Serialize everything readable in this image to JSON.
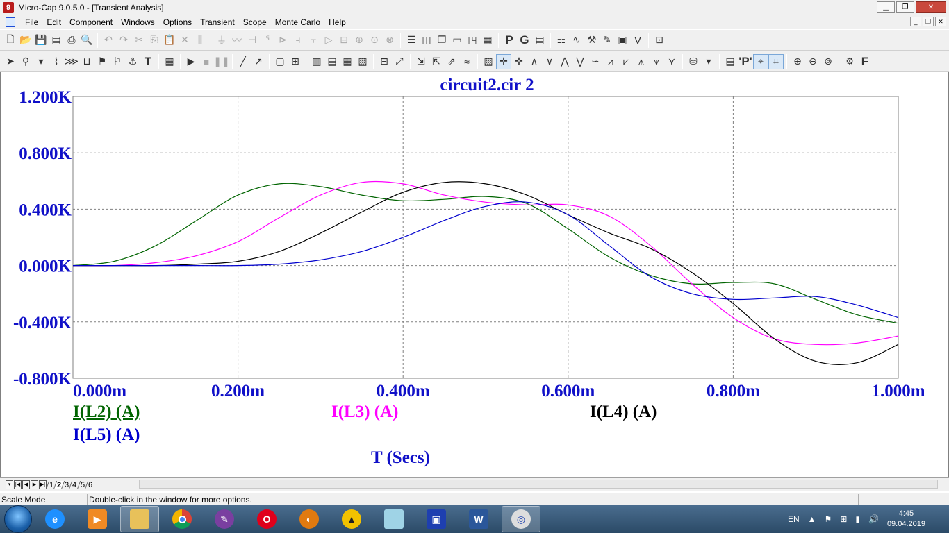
{
  "window": {
    "title": "Micro-Cap 9.0.5.0 - [Transient Analysis]",
    "buttons": {
      "minimize": "▁",
      "maximize": "❐",
      "close": "✕"
    }
  },
  "menu": {
    "items": [
      "File",
      "Edit",
      "Component",
      "Windows",
      "Options",
      "Transient",
      "Scope",
      "Monte Carlo",
      "Help"
    ]
  },
  "toolbar1": {
    "probe_p": "P",
    "probe_g": "G"
  },
  "toolbar2": {
    "text_tool": "T",
    "p_tool": "'P'",
    "f_tool": "F"
  },
  "chart_data": {
    "type": "line",
    "title": "circuit2.cir 2",
    "xlabel": "T (Secs)",
    "ylabel": "",
    "xlim": [
      0,
      1.0
    ],
    "ylim": [
      -0.8,
      1.2
    ],
    "x_ticks": [
      "0.000m",
      "0.200m",
      "0.400m",
      "0.600m",
      "0.800m",
      "1.000m"
    ],
    "y_ticks": [
      "1.200K",
      "0.800K",
      "0.400K",
      "0.000K",
      "-0.400K",
      "-0.800K"
    ],
    "grid": true,
    "x_unit_note": "time in ms (0 to 1.000m)",
    "series": [
      {
        "name": "I(L2) (A)",
        "color": "#006400",
        "x": [
          0,
          0.05,
          0.1,
          0.15,
          0.2,
          0.25,
          0.3,
          0.35,
          0.4,
          0.45,
          0.5,
          0.55,
          0.6,
          0.65,
          0.7,
          0.75,
          0.8,
          0.85,
          0.9,
          0.95,
          1.0
        ],
        "y": [
          0.0,
          0.03,
          0.14,
          0.32,
          0.5,
          0.58,
          0.56,
          0.5,
          0.46,
          0.47,
          0.49,
          0.44,
          0.26,
          0.06,
          -0.07,
          -0.13,
          -0.12,
          -0.13,
          -0.24,
          -0.35,
          -0.41
        ]
      },
      {
        "name": "I(L3) (A)",
        "color": "#ff00ff",
        "x": [
          0,
          0.05,
          0.1,
          0.15,
          0.2,
          0.25,
          0.3,
          0.35,
          0.4,
          0.45,
          0.5,
          0.55,
          0.6,
          0.65,
          0.7,
          0.75,
          0.8,
          0.85,
          0.9,
          0.95,
          1.0
        ],
        "y": [
          0.0,
          0.0,
          0.02,
          0.07,
          0.17,
          0.34,
          0.5,
          0.59,
          0.58,
          0.5,
          0.45,
          0.43,
          0.43,
          0.35,
          0.14,
          -0.13,
          -0.37,
          -0.52,
          -0.56,
          -0.55,
          -0.5
        ]
      },
      {
        "name": "I(L4) (A)",
        "color": "#000000",
        "x": [
          0,
          0.05,
          0.1,
          0.15,
          0.2,
          0.25,
          0.3,
          0.35,
          0.4,
          0.45,
          0.5,
          0.55,
          0.6,
          0.65,
          0.7,
          0.75,
          0.8,
          0.85,
          0.9,
          0.95,
          1.0
        ],
        "y": [
          0.0,
          0.0,
          0.0,
          0.01,
          0.03,
          0.1,
          0.23,
          0.38,
          0.52,
          0.59,
          0.58,
          0.5,
          0.36,
          0.23,
          0.12,
          -0.05,
          -0.27,
          -0.52,
          -0.68,
          -0.69,
          -0.56
        ]
      },
      {
        "name": "I(L5) (A)",
        "color": "#0000cd",
        "x": [
          0,
          0.05,
          0.1,
          0.15,
          0.2,
          0.25,
          0.3,
          0.35,
          0.4,
          0.45,
          0.5,
          0.55,
          0.6,
          0.65,
          0.7,
          0.75,
          0.8,
          0.85,
          0.9,
          0.95,
          1.0
        ],
        "y": [
          0.0,
          0.0,
          0.0,
          0.0,
          0.0,
          0.01,
          0.04,
          0.1,
          0.2,
          0.32,
          0.42,
          0.45,
          0.36,
          0.14,
          -0.08,
          -0.2,
          -0.24,
          -0.23,
          -0.22,
          -0.28,
          -0.37
        ]
      }
    ]
  },
  "page_tabs": [
    "1",
    "2",
    "3",
    "4",
    "5",
    "6"
  ],
  "active_tab": "2",
  "status": {
    "mode": "Scale Mode",
    "hint": "Double-click in the window for more options."
  },
  "taskbar": {
    "apps": [
      "internet-explorer",
      "media-player",
      "file-explorer",
      "chrome",
      "inkscape",
      "opera",
      "app-orange",
      "app-yellow",
      "notepad",
      "save-app",
      "word",
      "microcap"
    ],
    "tray_lang": "EN",
    "time": "4:45",
    "date": "09.04.2019"
  }
}
